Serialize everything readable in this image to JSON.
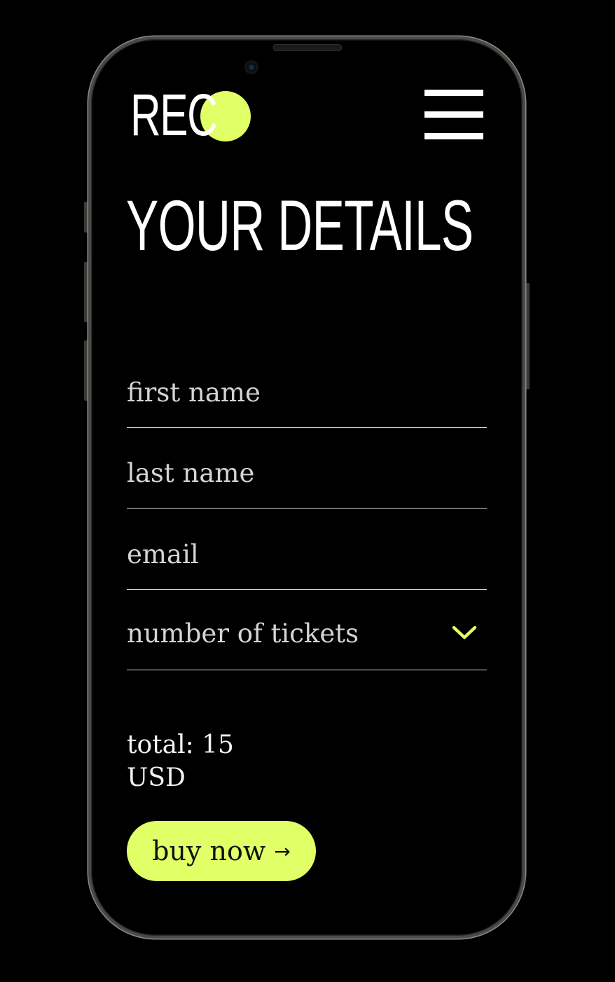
{
  "brand": {
    "logo_text": "REC",
    "accent_color": "#e1ff66"
  },
  "header": {
    "menu_icon": "hamburger-menu-icon"
  },
  "page": {
    "title": "YOUR DETAILS"
  },
  "form": {
    "first_name": {
      "placeholder": "first name",
      "value": ""
    },
    "last_name": {
      "placeholder": "last name",
      "value": ""
    },
    "email": {
      "placeholder": "email",
      "value": ""
    },
    "tickets": {
      "label": "number of tickets",
      "icon": "chevron-down-icon"
    }
  },
  "summary": {
    "total_label": "total: 15",
    "currency": "USD"
  },
  "actions": {
    "buy_label": "buy now",
    "buy_icon": "arrow-right-icon",
    "buy_arrow": "→"
  }
}
